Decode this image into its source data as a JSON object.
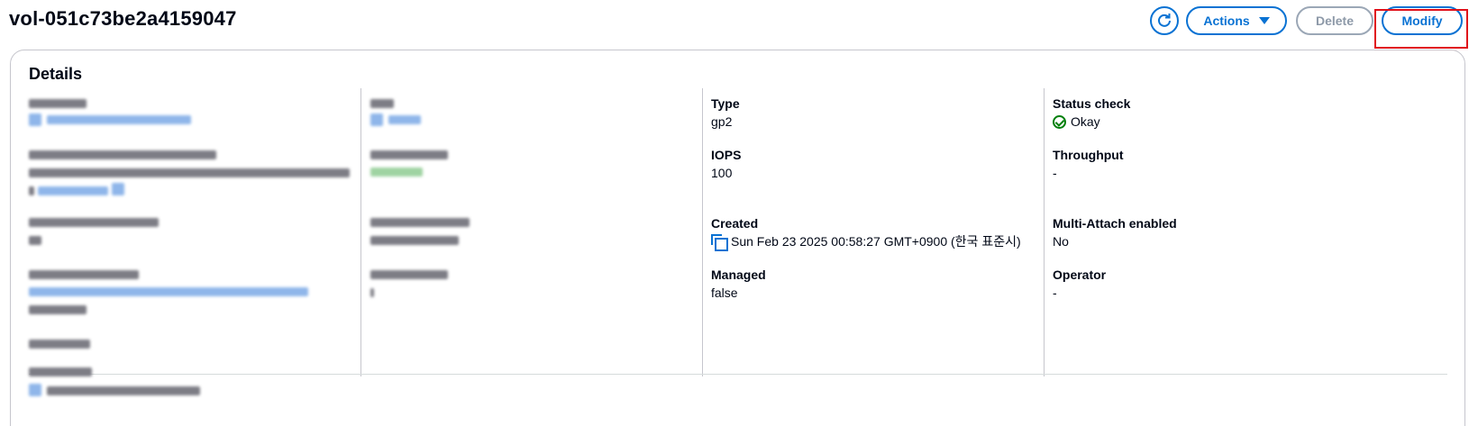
{
  "page": {
    "title": "vol-051c73be2a4159047"
  },
  "toolbar": {
    "refresh_icon": "refresh-icon",
    "actions_label": "Actions",
    "delete_label": "Delete",
    "modify_label": "Modify"
  },
  "details": {
    "title": "Details",
    "fields": {
      "type": {
        "label": "Type",
        "value": "gp2"
      },
      "iops": {
        "label": "IOPS",
        "value": "100"
      },
      "created": {
        "label": "Created",
        "value": "Sun Feb 23 2025 00:58:27 GMT+0900 (한국 표준시)"
      },
      "managed": {
        "label": "Managed",
        "value": "false"
      },
      "status_check": {
        "label": "Status check",
        "value": "Okay"
      },
      "throughput": {
        "label": "Throughput",
        "value": "-"
      },
      "multi_attach": {
        "label": "Multi-Attach enabled",
        "value": "No"
      },
      "operator": {
        "label": "Operator",
        "value": "-"
      }
    }
  },
  "colors": {
    "accent": "#0972d3",
    "success": "#037f0c",
    "highlight": "#e0101a",
    "disabled": "#8d99a8"
  }
}
